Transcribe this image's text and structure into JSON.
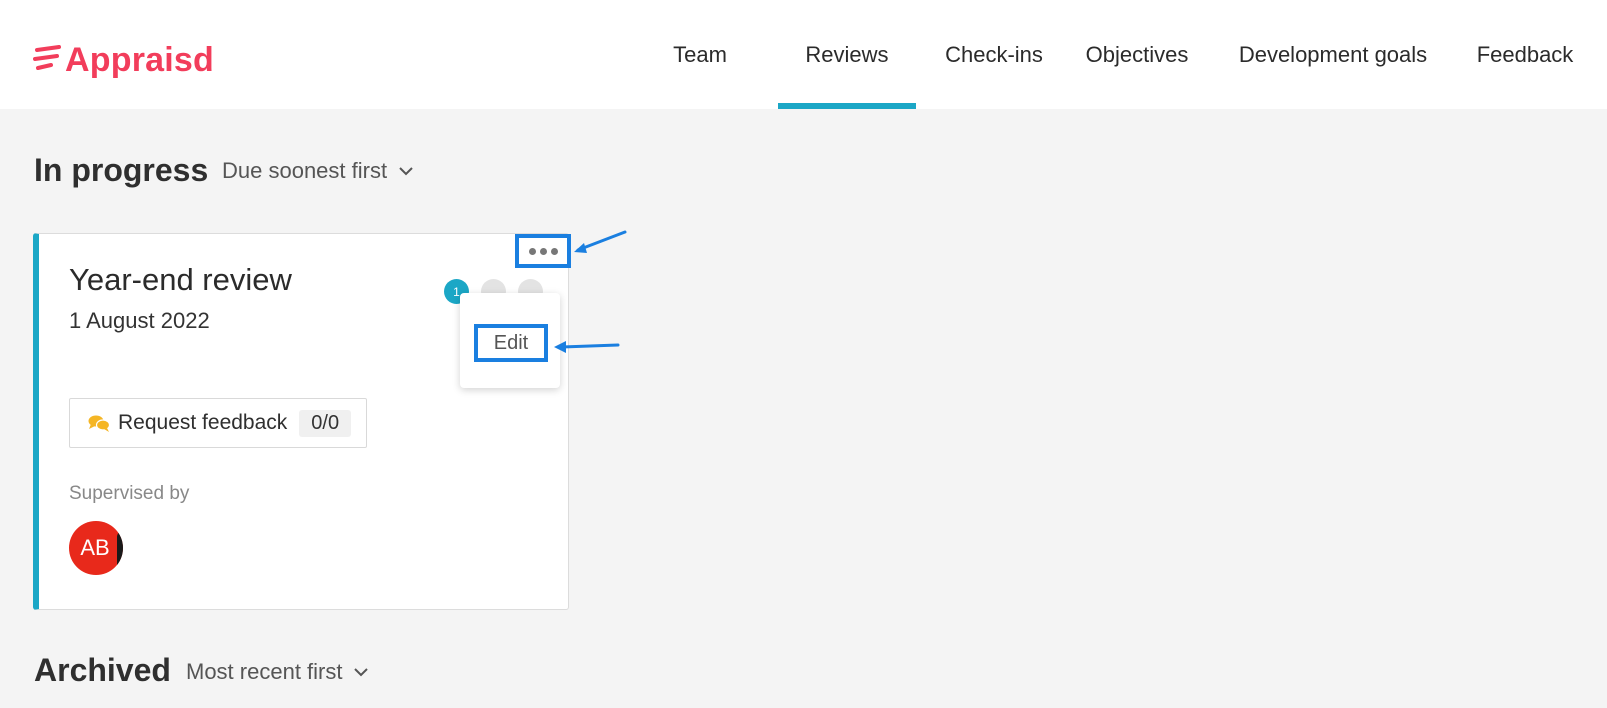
{
  "app": {
    "logo_text": "Appraisd",
    "brand_color": "#f23d5b",
    "accent_color": "#1ba7c6",
    "highlight_color": "#1a7fe0"
  },
  "nav": {
    "items": [
      {
        "label": "Team",
        "active": false
      },
      {
        "label": "Reviews",
        "active": true
      },
      {
        "label": "Check-ins",
        "active": false
      },
      {
        "label": "Objectives",
        "active": false
      },
      {
        "label": "Development goals",
        "active": false
      },
      {
        "label": "Feedback",
        "active": false
      }
    ]
  },
  "in_progress": {
    "title": "In progress",
    "sort_label": "Due soonest first"
  },
  "review_card": {
    "title": "Year-end review",
    "date": "1 August 2022",
    "step_current": "1",
    "more_icon": "ellipsis-icon",
    "menu": {
      "items": [
        {
          "label": "Edit"
        }
      ]
    },
    "feedback_button": {
      "label": "Request feedback",
      "count": "0/0",
      "icon": "chat-bubbles-icon"
    },
    "supervised_label": "Supervised by",
    "supervisor_initials": "AB"
  },
  "archived": {
    "title": "Archived",
    "sort_label": "Most recent first"
  }
}
